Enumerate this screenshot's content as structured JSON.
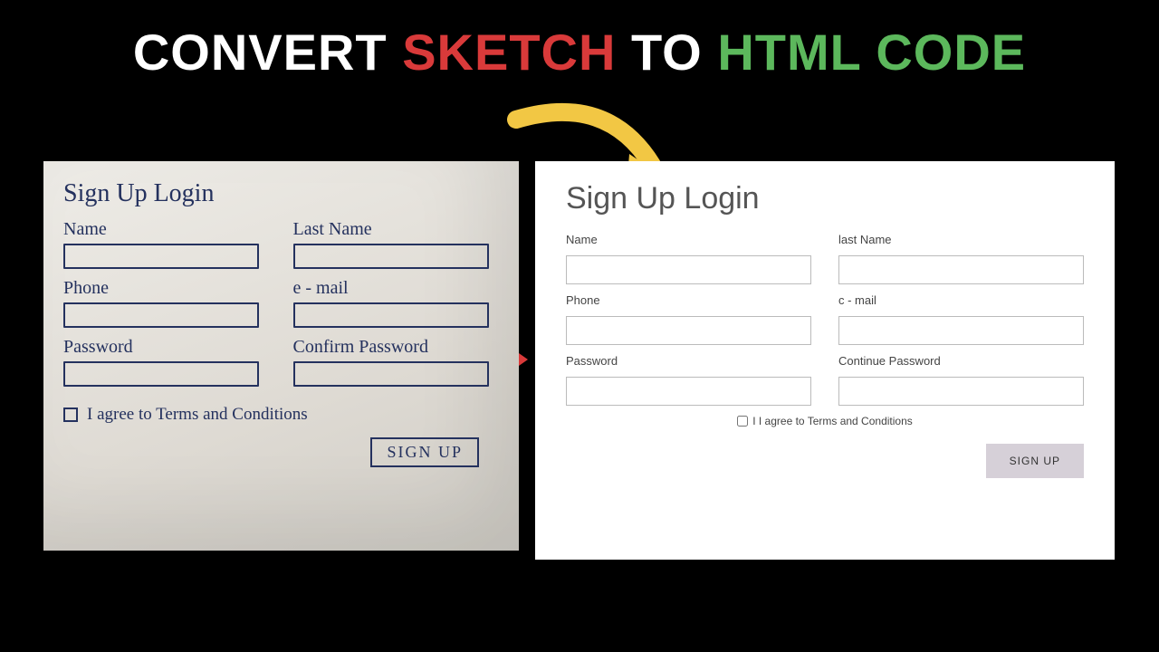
{
  "heading": {
    "w1": "CONVERT",
    "w2": "SKETCH",
    "w3": "TO",
    "w4": "HTML CODE"
  },
  "sketch": {
    "title": "Sign Up  Login",
    "name": "Name",
    "lastName": "Last Name",
    "phone": "Phone",
    "email": "e - mail",
    "password": "Password",
    "confirm": "Confirm Password",
    "agree": "I agree to Terms and Conditions",
    "button": "SIGN UP"
  },
  "rendered": {
    "title": "Sign Up Login",
    "name": "Name",
    "lastName": "last Name",
    "phone": "Phone",
    "email": "c - mail",
    "password": "Password",
    "confirm": "Continue Password",
    "agree": "I I agree to Terms and Conditions",
    "button": "SIGN UP"
  }
}
